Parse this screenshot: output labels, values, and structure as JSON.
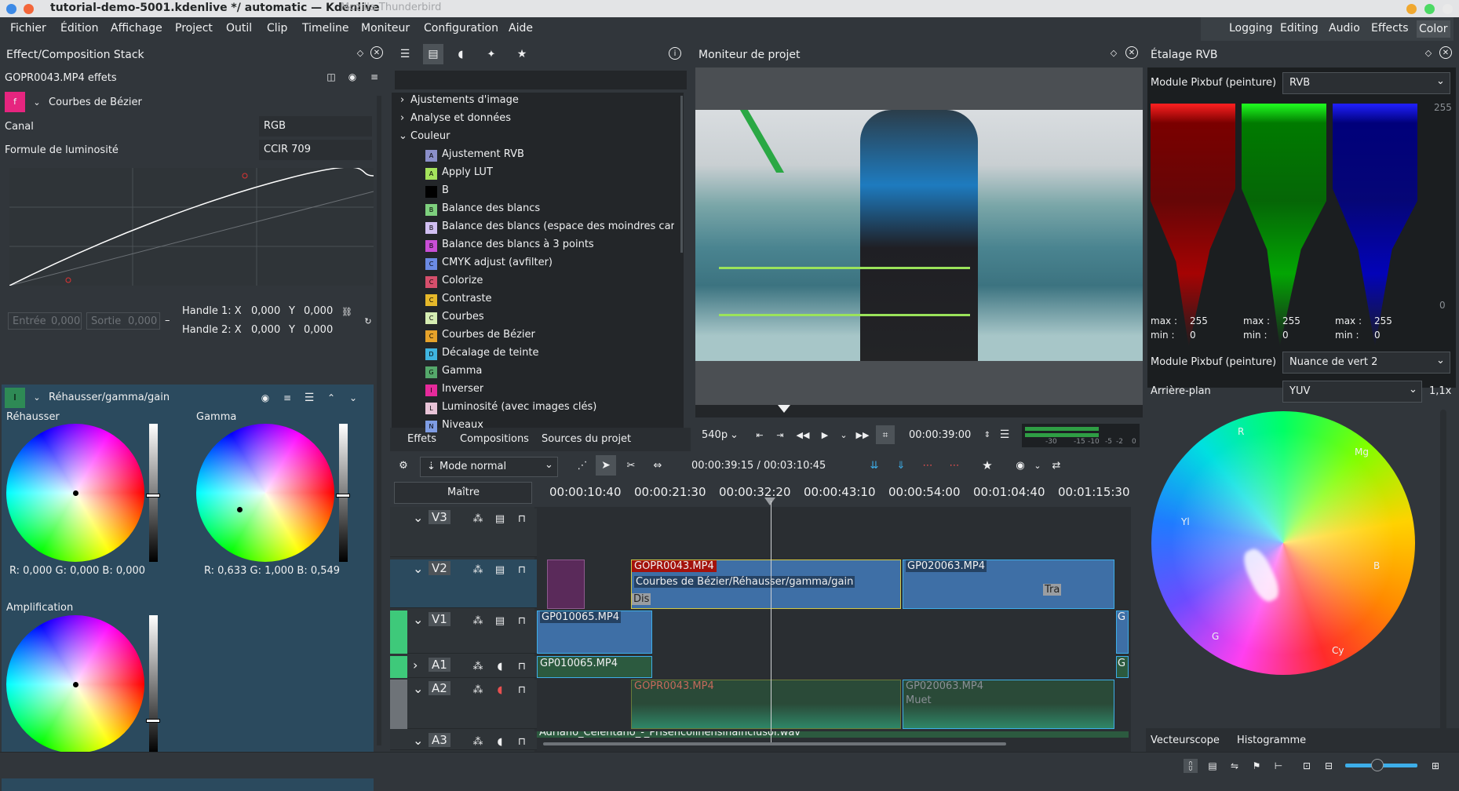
{
  "window": {
    "title": "tutorial-demo-5001.kdenlive */ automatic — Kdenlive",
    "background_title": "Mozilla Thunderbird"
  },
  "menu": [
    "Fichier",
    "Édition",
    "Affichage",
    "Project",
    "Outil",
    "Clip",
    "Timeline",
    "Moniteur",
    "Configuration",
    "Aide"
  ],
  "workspaces": [
    "Logging",
    "Editing",
    "Audio",
    "Effects",
    "Color"
  ],
  "effect_stack": {
    "title": "Effect/Composition Stack",
    "clip_label": "GOPR0043.MP4 effets",
    "bezier": {
      "name": "Courbes de Bézier",
      "canal_label": "Canal",
      "canal_value": "RGB",
      "formule_label": "Formule de luminosité",
      "formule_value": "CCIR 709",
      "entree": "Entrée",
      "entree_val": "0,000",
      "sortie": "Sortie",
      "sortie_val": "0,000",
      "h1": "Handle 1: X",
      "h1x": "0,000",
      "h1y_l": "Y",
      "h1y": "0,000",
      "h2": "Handle 2: X",
      "h2x": "0,000",
      "h2y_l": "Y",
      "h2y": "0,000"
    },
    "lgg": {
      "name": "Réhausser/gamma/gain",
      "lift": "Réhausser",
      "gamma": "Gamma",
      "gain": "Amplification",
      "lift_vals": "R: 0,000    G: 0,000    B: 0,000",
      "gamma_vals": "R: 0,633    G: 1,000    B: 0,549"
    }
  },
  "effects_list": {
    "categories": [
      "Ajustements d'image",
      "Analyse et données",
      "Couleur"
    ],
    "items": [
      {
        "i": "A",
        "c": "#8b8fc9",
        "l": "Ajustement RVB"
      },
      {
        "i": "A",
        "c": "#a5e35c",
        "l": "Apply LUT"
      },
      {
        "i": "",
        "c": "#000000",
        "l": "B"
      },
      {
        "i": "B",
        "c": "#7ed07e",
        "l": "Balance des blancs"
      },
      {
        "i": "B",
        "c": "#d1bff2",
        "l": "Balance des blancs (espace des moindres car"
      },
      {
        "i": "B",
        "c": "#c94ed6",
        "l": "Balance des blancs à 3 points"
      },
      {
        "i": "C",
        "c": "#6b8ae3",
        "l": "CMYK adjust (avfilter)"
      },
      {
        "i": "C",
        "c": "#d64f6c",
        "l": "Colorize"
      },
      {
        "i": "C",
        "c": "#e6b82a",
        "l": "Contraste"
      },
      {
        "i": "C",
        "c": "#d5ecb2",
        "l": "Courbes"
      },
      {
        "i": "C",
        "c": "#e6a22a",
        "l": "Courbes de Bézier"
      },
      {
        "i": "D",
        "c": "#3fb4e0",
        "l": "Décalage de teinte"
      },
      {
        "i": "G",
        "c": "#55a86b",
        "l": "Gamma"
      },
      {
        "i": "I",
        "c": "#e62a9b",
        "l": "Inverser"
      },
      {
        "i": "L",
        "c": "#e8c4d7",
        "l": "Luminosité (avec images clés)"
      },
      {
        "i": "N",
        "c": "#7e9ce3",
        "l": "Niveaux"
      }
    ],
    "tabs": [
      "Effets",
      "Compositions",
      "Sources du projet"
    ]
  },
  "monitor": {
    "title": "Moniteur de projet",
    "zoom": "540p",
    "timecode": "00:00:39:00",
    "meter": [
      "-30",
      "-15",
      "-10",
      "-5",
      "-2",
      "0"
    ]
  },
  "scopes": {
    "title": "Étalage RVB",
    "mode_label": "Module Pixbuf (peinture)",
    "mode_value": "RVB",
    "top": "255",
    "bottom": "0",
    "stats": [
      {
        "max": "max :",
        "maxv": "255",
        "min": "min :",
        "minv": "0"
      },
      {
        "max": "max :",
        "maxv": "255",
        "min": "min :",
        "minv": "0"
      },
      {
        "max": "max :",
        "maxv": "255",
        "min": "min :",
        "minv": "0"
      }
    ],
    "vec_mode_label": "Module Pixbuf (peinture)",
    "vec_mode_value": "Nuance de vert 2",
    "bg_label": "Arrière-plan",
    "bg_value": "YUV",
    "zoom": "1,1x",
    "targets": [
      "R",
      "Mg",
      "B",
      "Cy",
      "G",
      "Yl"
    ],
    "tabs": [
      "Vecteurscope",
      "Histogramme"
    ]
  },
  "timeline": {
    "mode": "Mode normal",
    "position": "00:00:39:15 / 00:03:10:45",
    "master": "Maître",
    "ruler": [
      "00:00:10:40",
      "00:00:21:30",
      "00:00:32:20",
      "00:00:43:10",
      "00:00:54:00",
      "00:01:04:40",
      "00:01:15:30"
    ],
    "tracks": [
      "V3",
      "V2",
      "V1",
      "A1",
      "A2",
      "A3"
    ],
    "clips": {
      "v2a": "GOPR0043.MP4",
      "v2a_fx": "Courbes de Bézier/Réhausser/gamma/gain",
      "v2a_d": "Dis",
      "v2b": "GP020063.MP4",
      "v2b_t": "Tra",
      "v1": "GP010065.MP4",
      "v1r": "G",
      "a1": "GP010065.MP4",
      "a1r": "G",
      "a2a": "GOPR0043.MP4",
      "a2b": "GP020063.MP4",
      "a2b_m": "Muet",
      "a3": "Adriano_Celentano_-_Prisencolinensinainciusol.wav"
    }
  },
  "colors": {
    "accent": "#3daee9",
    "window_bg": "#31363b",
    "field_bg": "#232629",
    "clip_v": "#3e6fa6",
    "clip_a": "#2c5a3f",
    "sel_red": "#a3120c"
  }
}
